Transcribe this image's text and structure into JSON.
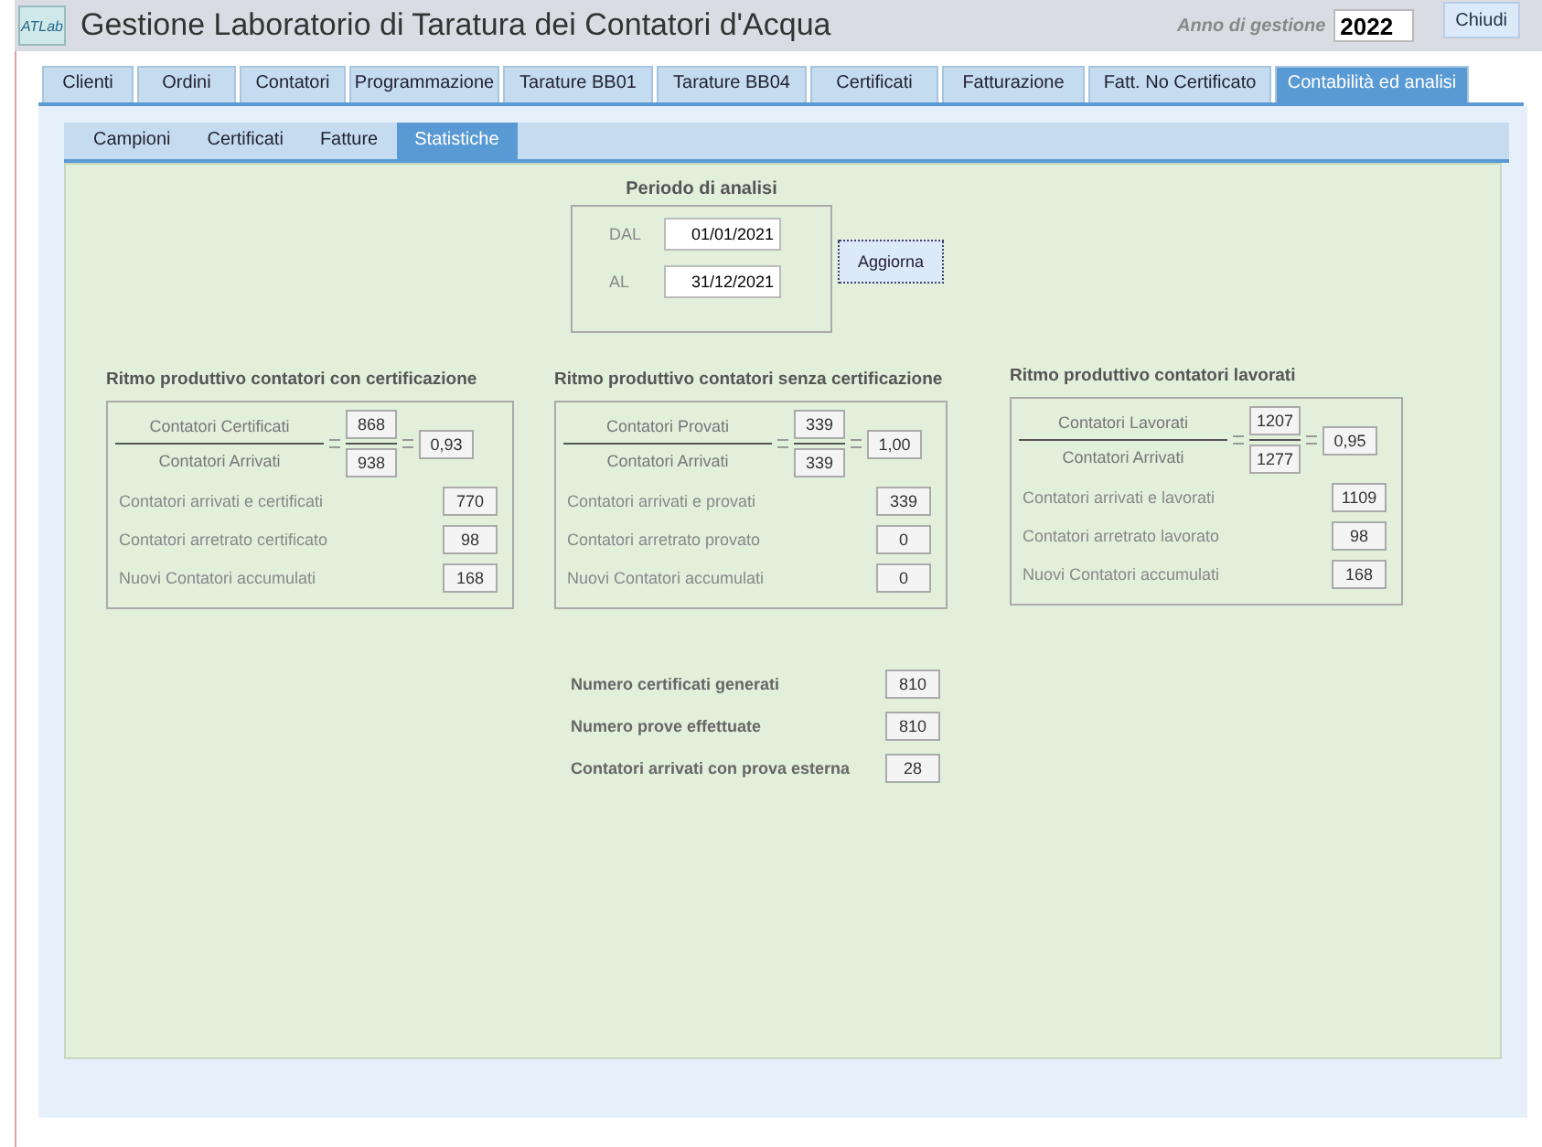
{
  "header": {
    "logo": "ATLab",
    "title": "Gestione Laboratorio di Taratura dei Contatori d'Acqua",
    "year_label": "Anno di gestione",
    "year_value": "2022",
    "close_button": "Chiudi"
  },
  "tabs": [
    {
      "label": "Clienti",
      "selected": false
    },
    {
      "label": "Ordini",
      "selected": false
    },
    {
      "label": "Contatori",
      "selected": false
    },
    {
      "label": "Programmazione",
      "selected": false
    },
    {
      "label": "Tarature BB01",
      "selected": false
    },
    {
      "label": "Tarature BB04",
      "selected": false
    },
    {
      "label": "Certificati",
      "selected": false
    },
    {
      "label": "Fatturazione",
      "selected": false
    },
    {
      "label": "Fatt. No Certificato",
      "selected": false
    },
    {
      "label": "Contabilità ed analisi",
      "selected": true
    }
  ],
  "subtabs": [
    {
      "label": "Campioni",
      "selected": false
    },
    {
      "label": "Certificati",
      "selected": false
    },
    {
      "label": "Fatture",
      "selected": false
    },
    {
      "label": "Statistiche",
      "selected": true
    }
  ],
  "period": {
    "title": "Periodo di analisi",
    "from_label": "DAL",
    "from_value": "01/01/2021",
    "to_label": "AL",
    "to_value": "31/12/2021",
    "refresh_button": "Aggiorna"
  },
  "panels": [
    {
      "title": "Ritmo produttivo contatori con certificazione",
      "numerator_label": "Contatori Certificati",
      "numerator_value": "868",
      "denominator_label": "Contatori Arrivati",
      "denominator_value": "938",
      "ratio": "0,93",
      "rows": [
        {
          "label": "Contatori arrivati e certificati",
          "value": "770"
        },
        {
          "label": "Contatori arretrato certificato",
          "value": "98"
        },
        {
          "label": "Nuovi Contatori accumulati",
          "value": "168"
        }
      ]
    },
    {
      "title": "Ritmo produttivo contatori senza certificazione",
      "numerator_label": "Contatori Provati",
      "numerator_value": "339",
      "denominator_label": "Contatori Arrivati",
      "denominator_value": "339",
      "ratio": "1,00",
      "rows": [
        {
          "label": "Contatori arrivati e provati",
          "value": "339"
        },
        {
          "label": "Contatori arretrato provato",
          "value": "0"
        },
        {
          "label": "Nuovi Contatori accumulati",
          "value": "0"
        }
      ]
    },
    {
      "title": "Ritmo produttivo contatori lavorati",
      "numerator_label": "Contatori Lavorati",
      "numerator_value": "1207",
      "denominator_label": "Contatori Arrivati",
      "denominator_value": "1277",
      "ratio": "0,95",
      "rows": [
        {
          "label": "Contatori arrivati e lavorati",
          "value": "1109"
        },
        {
          "label": "Contatori arretrato lavorato",
          "value": "98"
        },
        {
          "label": "Nuovi Contatori accumulati",
          "value": "168"
        }
      ]
    }
  ],
  "totals": [
    {
      "label": "Numero certificati generati",
      "value": "810"
    },
    {
      "label": "Numero prove effettuate",
      "value": "810"
    },
    {
      "label": "Contatori arrivati con prova esterna",
      "value": "28"
    }
  ]
}
